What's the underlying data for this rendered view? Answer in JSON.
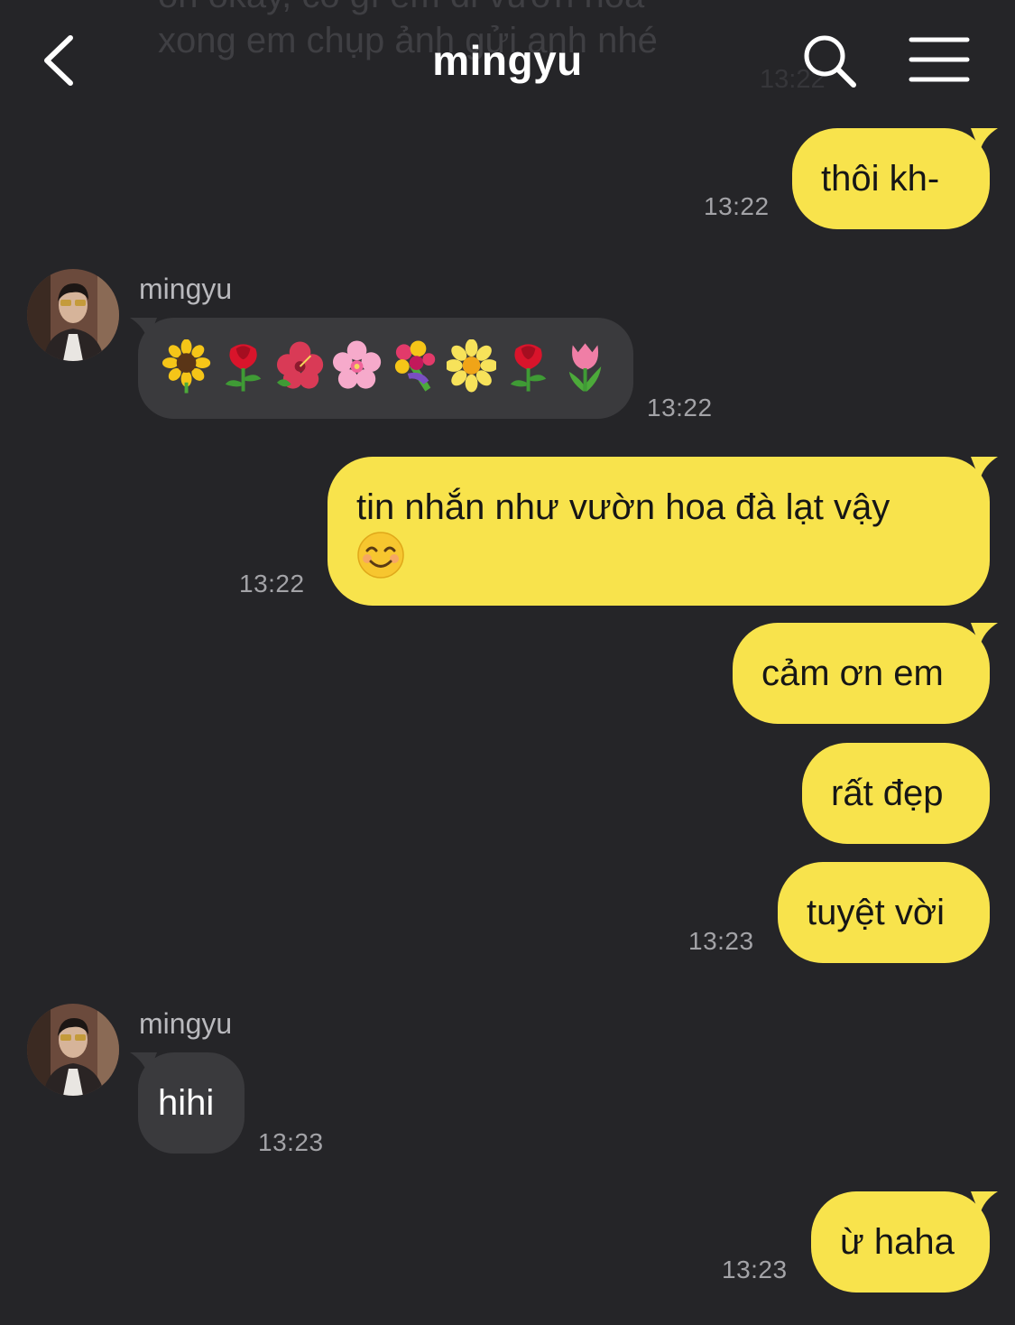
{
  "header": {
    "title": "mingyu",
    "back_icon": "chevron-left-icon",
    "search_icon": "search-icon",
    "menu_icon": "hamburger-menu-icon"
  },
  "ghost": {
    "lines": "on okay, có gì em đi vườn hoa\nxong em chụp ảnh gửi anh nhé",
    "time": "13:22"
  },
  "messages": [
    {
      "side": "out",
      "text": "thôi kh-",
      "time": "13:22"
    },
    {
      "side": "in",
      "sender": "mingyu",
      "emojis": [
        "sunflower",
        "rose",
        "hibiscus",
        "cherry-blossom",
        "bouquet",
        "blossom",
        "rose",
        "tulip"
      ],
      "time": "13:22"
    },
    {
      "side": "out",
      "text": "tin nhắn như vườn hoa đà lạt vậy",
      "emoji": "smiling-face",
      "time": "13:22"
    },
    {
      "side": "out",
      "text": "cảm ơn em"
    },
    {
      "side": "out",
      "text": "rất đẹp"
    },
    {
      "side": "out",
      "text": "tuyệt vời",
      "time": "13:23"
    },
    {
      "side": "in",
      "sender": "mingyu",
      "text": "hihi",
      "time": "13:23"
    },
    {
      "side": "out",
      "text": "ừ haha",
      "time": "13:23"
    }
  ],
  "colors": {
    "background": "#252528",
    "outgoing_bubble": "#f8e34c",
    "incoming_bubble": "#3a3a3d",
    "timestamp": "#a3a3a7"
  }
}
